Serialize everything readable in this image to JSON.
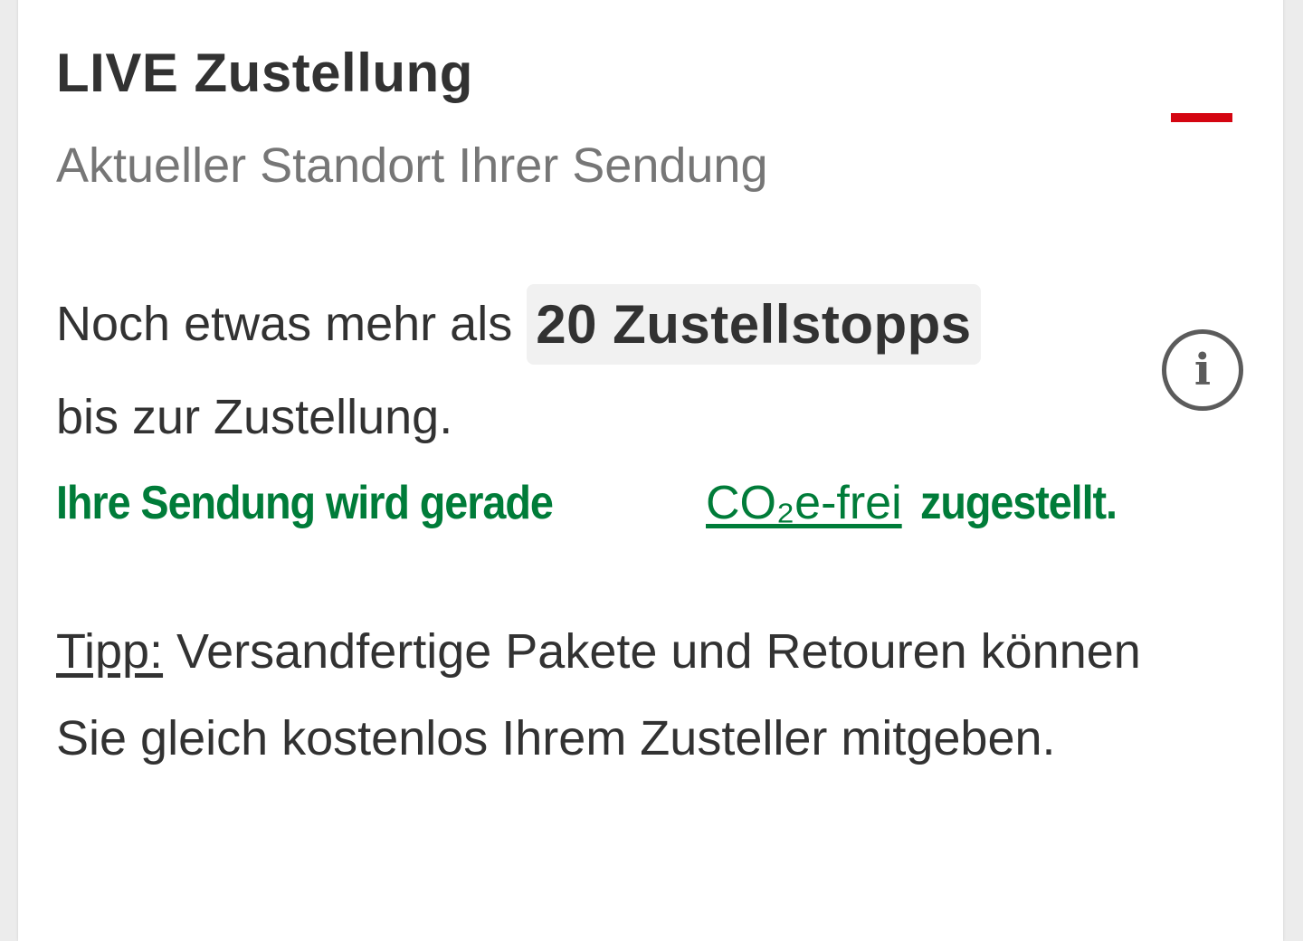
{
  "card": {
    "title": "LIVE Zustellung",
    "subtitle": "Aktueller Standort Ihrer Sendung",
    "collapse_icon": "minus-icon",
    "accent_color": "#d40511"
  },
  "stops": {
    "prefix": "Noch etwas mehr als",
    "highlight": "20 Zustellstopps",
    "suffix": "bis zur Zustellung.",
    "info_icon": "info-circle-icon",
    "info_glyph": "i"
  },
  "co2": {
    "before": "Ihre Sendung wird gerade",
    "link": "CO₂e-frei",
    "after": "zugestellt.",
    "color": "#007c39"
  },
  "tip": {
    "label": "Tipp:",
    "text": " Versandfertige Pakete und Retouren können Sie gleich kostenlos Ihrem Zusteller mitgeben."
  }
}
